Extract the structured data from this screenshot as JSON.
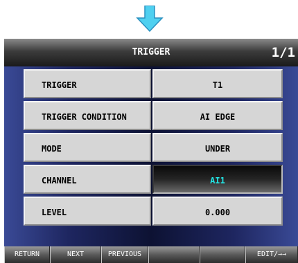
{
  "arrow_icon": "down-arrow-icon",
  "header": {
    "title": "TRIGGER",
    "page": "1/1"
  },
  "rows": [
    {
      "label": "TRIGGER",
      "value": "T1"
    },
    {
      "label": "TRIGGER CONDITION",
      "value": "AI EDGE"
    },
    {
      "label": "MODE",
      "value": "UNDER"
    },
    {
      "label": "CHANNEL",
      "value": "AI1"
    },
    {
      "label": "LEVEL",
      "value": "0.000"
    }
  ],
  "function_keys": [
    "RETURN",
    "NEXT",
    "PREVIOUS",
    "",
    "",
    "EDIT/→→"
  ],
  "colors": {
    "selected_text": "#22e6e6",
    "cell_bg": "#d6d6d6",
    "arrow": "#4fd0f0"
  }
}
